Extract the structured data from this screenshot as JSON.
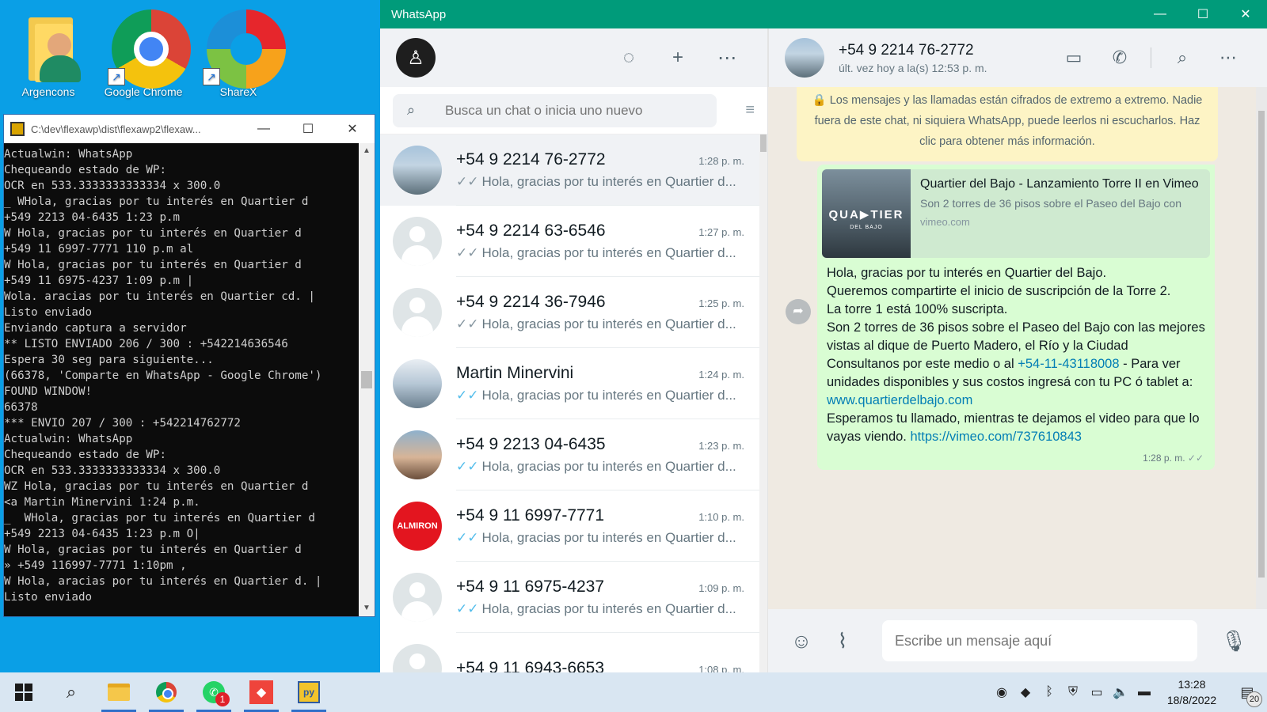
{
  "desktop": {
    "icons": [
      {
        "label": "Argencons",
        "icon": "user-folder-icon"
      },
      {
        "label": "Google Chrome",
        "icon": "chrome-icon"
      },
      {
        "label": "ShareX",
        "icon": "sharex-icon"
      }
    ]
  },
  "console": {
    "title": "C:\\dev\\flexawp\\dist\\flexawp2\\flexaw...",
    "lines": [
      "Actualwin: WhatsApp",
      "Chequeando estado de WP:",
      "OCR en 533.3333333333334 x 300.0",
      "_ WHola, gracias por tu interés en Quartier d",
      "+549 2213 04-6435 1:23 p.m",
      "W Hola, gracias por tu interés en Quartier d",
      "+549 11 6997-7771 110 p.m al",
      "W Hola, gracias por tu interés en Quartier d",
      "+549 11 6975-4237 1:09 p.m |",
      "Wola. aracias por tu interés en Quartier cd. |",
      "Listo enviado",
      "Enviando captura a servidor",
      "** LISTO ENVIADO 206 / 300 : +542214636546",
      "Espera 30 seg para siguiente...",
      "(66378, 'Comparte en WhatsApp - Google Chrome')",
      "FOUND WINDOW!",
      "66378",
      "*** ENVIO 207 / 300 : +542214762772",
      "Actualwin: WhatsApp",
      "Chequeando estado de WP:",
      "OCR en 533.3333333333334 x 300.0",
      "WZ Hola, gracias por tu interés en Quartier d",
      "<a Martin Minervini 1:24 p.m.",
      "_  WHola, gracias por tu interés en Quartier d",
      "+549 2213 04-6435 1:23 p.m O|",
      "W Hola, gracias por tu interés en Quartier d",
      "» +549 116997-7771 1:10pm ,",
      "W Hola, aracias por tu interés en Quartier d. |",
      "Listo enviado"
    ]
  },
  "whatsapp": {
    "title": "WhatsApp",
    "search_placeholder": "Busca un chat o inicia uno nuevo",
    "chats": [
      {
        "name": "+54 9 2214 76-2772",
        "time": "1:28 p. m.",
        "preview": "Hola, gracias por tu interés en Quartier d...",
        "read": false,
        "avatar": "photo-city",
        "active": true
      },
      {
        "name": "+54 9 2214 63-6546",
        "time": "1:27 p. m.",
        "preview": "Hola, gracias por tu interés en Quartier d...",
        "read": false,
        "avatar": "default",
        "active": false
      },
      {
        "name": "+54 9 2214 36-7946",
        "time": "1:25 p. m.",
        "preview": "Hola, gracias por tu interés en Quartier d...",
        "read": false,
        "avatar": "default",
        "active": false
      },
      {
        "name": "Martin Minervini",
        "time": "1:24 p. m.",
        "preview": "Hola, gracias por tu interés en Quartier d...",
        "read": true,
        "avatar": "photo-water",
        "active": false
      },
      {
        "name": "+54 9 2213 04-6435",
        "time": "1:23 p. m.",
        "preview": "Hola, gracias por tu interés en Quartier d...",
        "read": true,
        "avatar": "photo-man",
        "active": false
      },
      {
        "name": "+54 9 11 6997-7771",
        "time": "1:10 p. m.",
        "preview": "Hola, gracias por tu interés en Quartier d...",
        "read": true,
        "avatar": "almiron",
        "active": false
      },
      {
        "name": "+54 9 11 6975-4237",
        "time": "1:09 p. m.",
        "preview": "Hola, gracias por tu interés en Quartier d...",
        "read": true,
        "avatar": "default",
        "active": false
      },
      {
        "name": "+54 9 11 6943-6653",
        "time": "1:08 p. m.",
        "preview": "",
        "read": true,
        "avatar": "default",
        "active": false
      }
    ],
    "conversation": {
      "name": "+54 9 2214 76-2772",
      "status": "últ. vez hoy a la(s) 12:53 p. m.",
      "encryption_notice": "Los mensajes y las llamadas están cifrados de extremo a extremo. Nadie fuera de este chat, ni siquiera WhatsApp, puede leerlos ni escucharlos. Haz clic para obtener más información.",
      "link_preview": {
        "title": "Quartier del Bajo - Lanzamiento Torre II en Vimeo",
        "description": "Son 2 torres de 36 pisos sobre el Paseo del Bajo con",
        "domain": "vimeo.com",
        "thumb_brand": "QUA▶TIER",
        "thumb_sub": "DEL BAJO"
      },
      "message": {
        "line1": "Hola, gracias por tu interés en Quartier del Bajo.",
        "line2": "Queremos compartirte el inicio de suscripción de la Torre 2.",
        "line3": "La torre 1 está 100% suscripta.",
        "line4": "Son 2 torres de 36 pisos sobre el Paseo del Bajo con las mejores vistas al dique de Puerto Madero, el Río y la Ciudad",
        "line5_a": "Consultanos por este medio o al ",
        "phone": "+54-11-43118008",
        "line5_b": " - Para ver unidades disponibles y sus costos ingresá con tu PC ó tablet a: ",
        "site": "www.quartierdelbajo.com",
        "line6": "Esperamos tu llamado, mientras te dejamos el video para que lo vayas viendo. ",
        "video": "https://vimeo.com/737610843",
        "time": "1:28 p. m."
      },
      "composer_placeholder": "Escribe un mensaje aquí"
    }
  },
  "taskbar": {
    "whatsapp_badge": "1",
    "time": "13:28",
    "date": "18/8/2022",
    "notifications": "20"
  }
}
